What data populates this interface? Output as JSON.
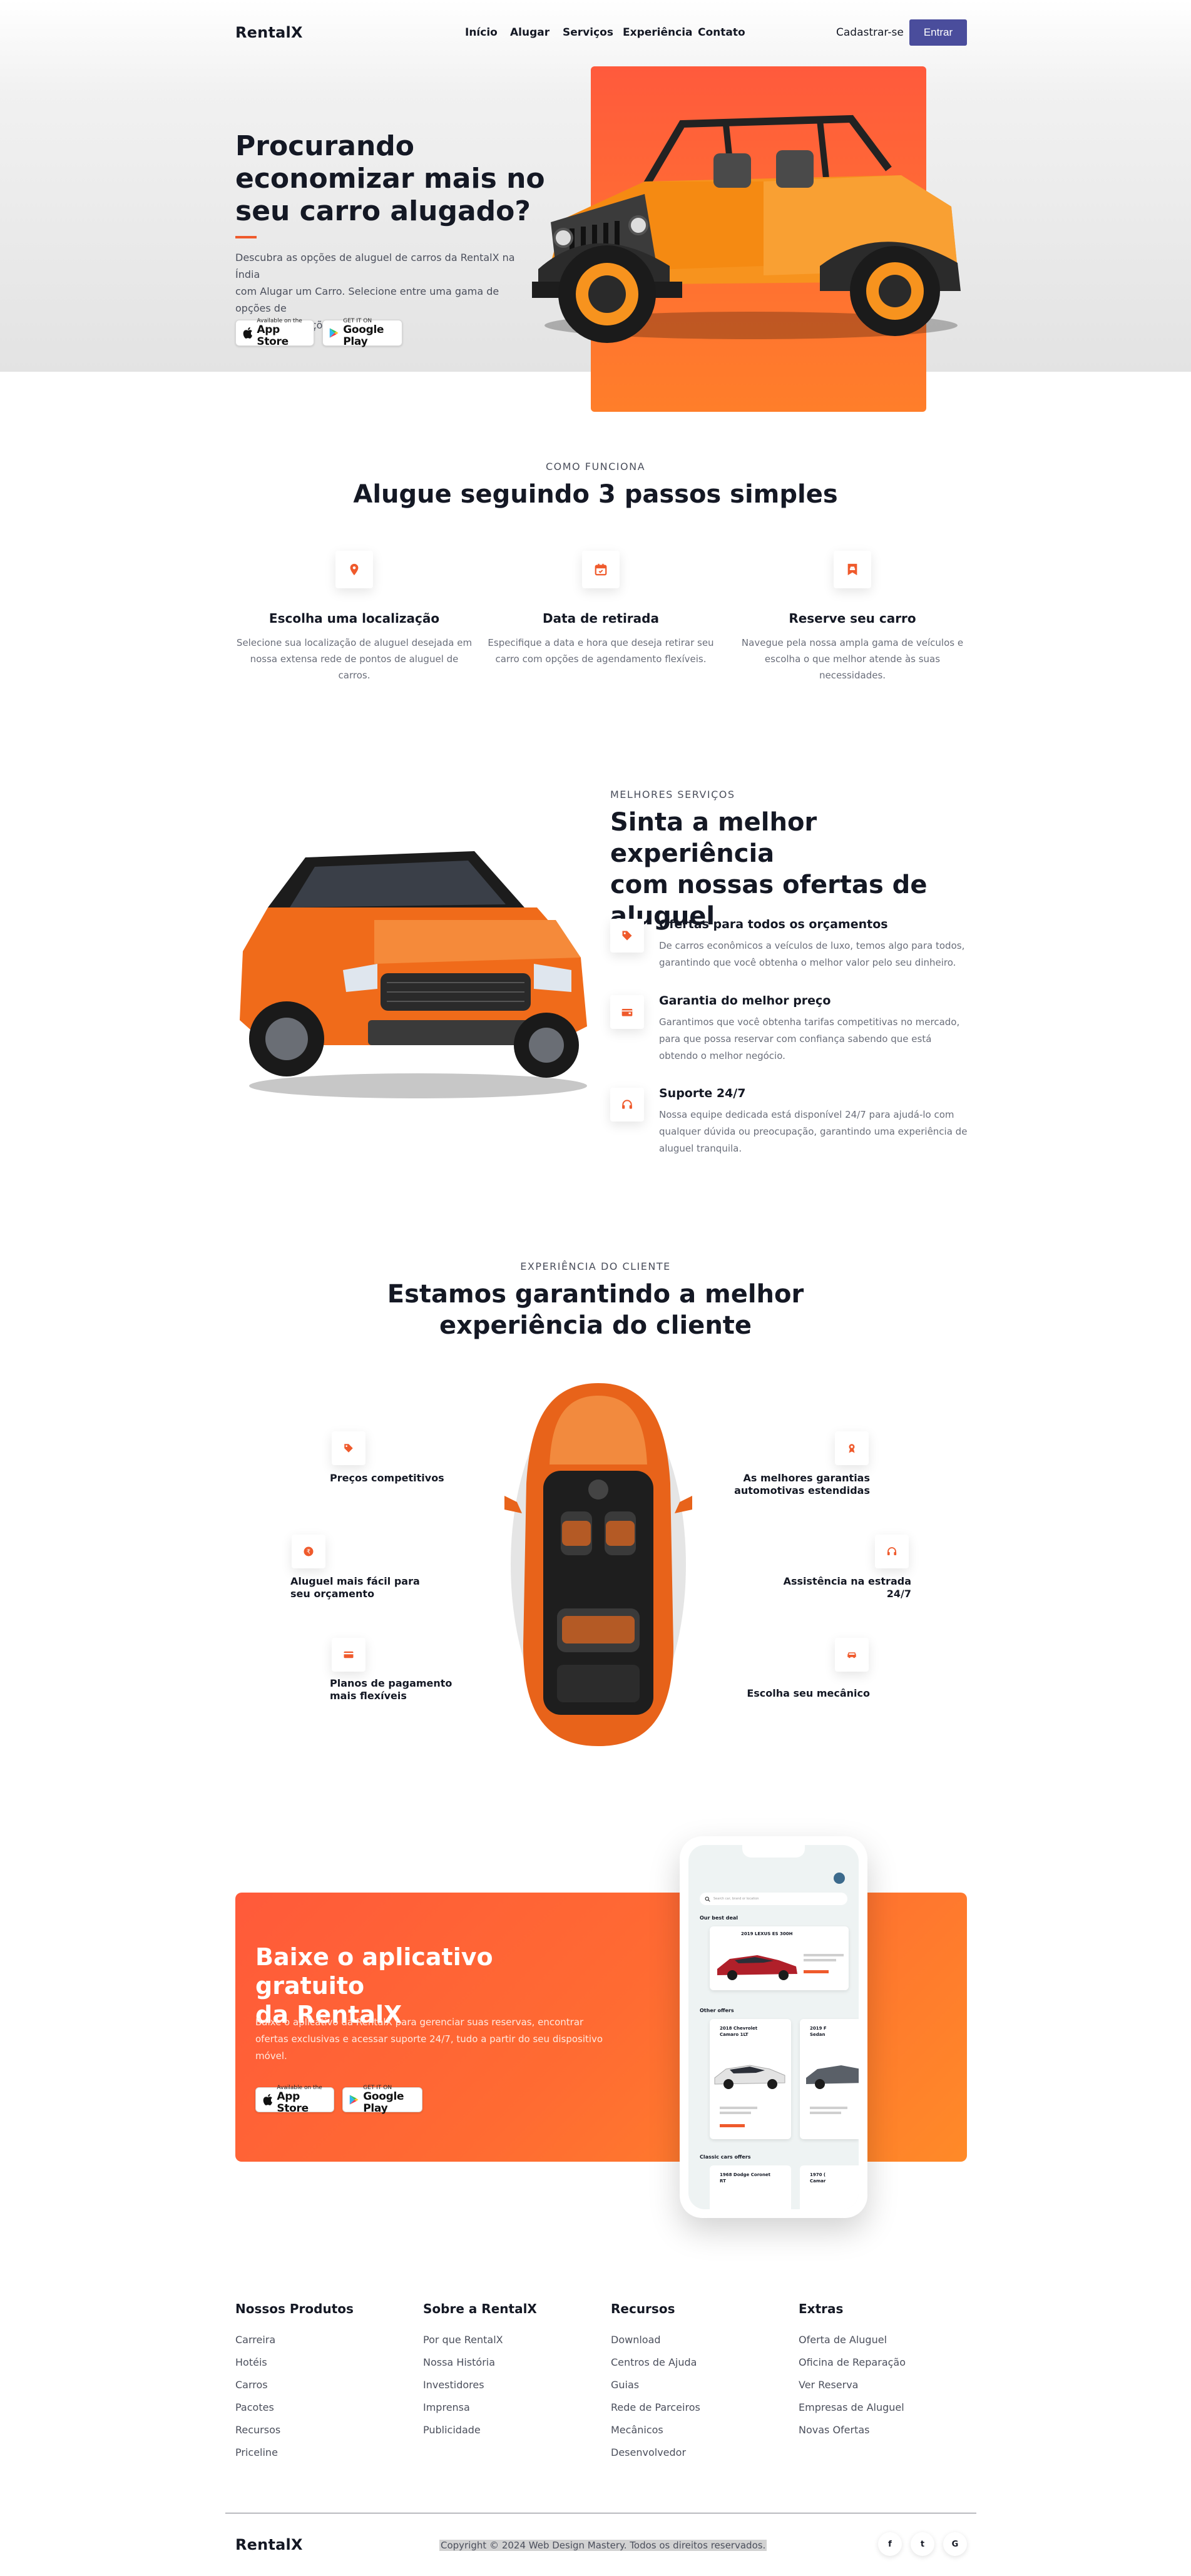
{
  "brand": "RentalX",
  "nav": {
    "links": [
      "Início",
      "Alugar",
      "Serviços",
      "Experiência",
      "Contato"
    ],
    "signup": "Cadastrar-se",
    "login": "Entrar"
  },
  "hero": {
    "title_lines": [
      "Procurando",
      "economizar mais no",
      "seu carro alugado?"
    ],
    "desc_lines": [
      "Descubra as opções de aluguel de carros da RentalX na Índia",
      "com Alugar um Carro. Selecione entre uma gama de opções de",
      "carros e promoções locais."
    ],
    "appstore_small": "Available on the",
    "appstore_big": "App Store",
    "googleplay_small": "GET IT ON",
    "googleplay_big": "Google Play"
  },
  "steps": {
    "eyebrow": "COMO FUNCIONA",
    "title": "Alugue seguindo 3 passos simples",
    "items": [
      {
        "icon": "location-pin-icon",
        "title": "Escolha uma localização",
        "desc_lines": [
          "Selecione sua localização de aluguel desejada em",
          "nossa extensa rede de pontos de aluguel de",
          "carros."
        ]
      },
      {
        "icon": "calendar-icon",
        "title": "Data de retirada",
        "desc_lines": [
          "Especifique a data e hora que deseja retirar seu",
          "carro com opções de agendamento flexíveis."
        ]
      },
      {
        "icon": "bookmark-car-icon",
        "title": "Reserve seu carro",
        "desc_lines": [
          "Navegue pela nossa ampla gama de veículos e",
          "escolha o que melhor atende às suas",
          "necessidades."
        ]
      }
    ]
  },
  "services": {
    "eyebrow": "MELHORES SERVIÇOS",
    "title_lines": [
      "Sinta a melhor experiência",
      "com nossas ofertas de",
      "aluguel"
    ],
    "items": [
      {
        "icon": "tag-icon",
        "title": "Ofertas para todos os orçamentos",
        "desc_lines": [
          "De carros econômicos a veículos de luxo, temos algo para todos,",
          "garantindo que você obtenha o melhor valor pelo seu dinheiro."
        ]
      },
      {
        "icon": "wallet-icon",
        "title": "Garantia do melhor preço",
        "desc_lines": [
          "Garantimos que você obtenha tarifas competitivas no mercado,",
          "para que possa reservar com confiança sabendo que está",
          "obtendo o melhor negócio."
        ]
      },
      {
        "icon": "headset-icon",
        "title": "Suporte 24/7",
        "desc_lines": [
          "Nossa equipe dedicada está disponível 24/7 para ajudá-lo com",
          "qualquer dúvida ou preocupação, garantindo uma experiência de",
          "aluguel tranquila."
        ]
      }
    ]
  },
  "experience": {
    "eyebrow": "EXPERIÊNCIA DO CLIENTE",
    "title_lines": [
      "Estamos garantindo a melhor",
      "experiência do cliente"
    ],
    "left": [
      {
        "icon": "price-tag-icon",
        "label_lines": [
          "Preços competitivos"
        ]
      },
      {
        "icon": "coin-icon",
        "label_lines": [
          "Aluguel mais fácil para",
          "seu orçamento"
        ]
      },
      {
        "icon": "card-icon",
        "label_lines": [
          "Planos de pagamento",
          "mais flexíveis"
        ]
      }
    ],
    "right": [
      {
        "icon": "award-icon",
        "label_lines": [
          "As melhores garantias",
          "automotivas estendidas"
        ]
      },
      {
        "icon": "support-icon",
        "label_lines": [
          "Assistência na estrada",
          "24/7"
        ]
      },
      {
        "icon": "car-icon",
        "label_lines": [
          "Escolha seu mecânico"
        ]
      }
    ]
  },
  "app": {
    "title_lines": [
      "Baixe o aplicativo gratuito",
      "da RentalX"
    ],
    "desc_lines": [
      "Baixe o aplicativo da RentalX para gerenciar suas reservas, encontrar",
      "ofertas exclusivas e acessar suporte 24/7, tudo a partir do seu dispositivo",
      "móvel."
    ],
    "phone": {
      "search_placeholder": "Search car, brand or location",
      "best_deal": "Our best deal",
      "deal_car": "2019 LEXUS ES 300H",
      "other_offers": "Other offers",
      "offer1": [
        "2018 Chevrolet",
        "Camaro 1LT"
      ],
      "offer2": [
        "2019 F",
        "Sedan"
      ],
      "classic": "Classic cars offers",
      "classic1": [
        "1968 Dodge Coronet",
        "RT"
      ],
      "classic2": [
        "1970 (",
        "Camar"
      ]
    }
  },
  "footer": {
    "columns": [
      {
        "title": "Nossos Produtos",
        "links": [
          "Carreira",
          "Hotéis",
          "Carros",
          "Pacotes",
          "Recursos",
          "Priceline"
        ]
      },
      {
        "title": "Sobre a RentalX",
        "links": [
          "Por que RentalX",
          "Nossa História",
          "Investidores",
          "Imprensa",
          "Publicidade"
        ]
      },
      {
        "title": "Recursos",
        "links": [
          "Download",
          "Centros de Ajuda",
          "Guias",
          "Rede de Parceiros",
          "Mecânicos",
          "Desenvolvedor"
        ]
      },
      {
        "title": "Extras",
        "links": [
          "Oferta de Aluguel",
          "Oficina de Reparação",
          "Ver Reserva",
          "Empresas de Aluguel",
          "Novas Ofertas"
        ]
      }
    ],
    "copyright": "Copyright © 2024 Web Design Mastery. Todos os direitos reservados.",
    "social": [
      "f",
      "t",
      "G"
    ]
  },
  "colors": {
    "accent": "#ef5a2c",
    "primary": "#4a4d9c",
    "text": "#141824"
  }
}
